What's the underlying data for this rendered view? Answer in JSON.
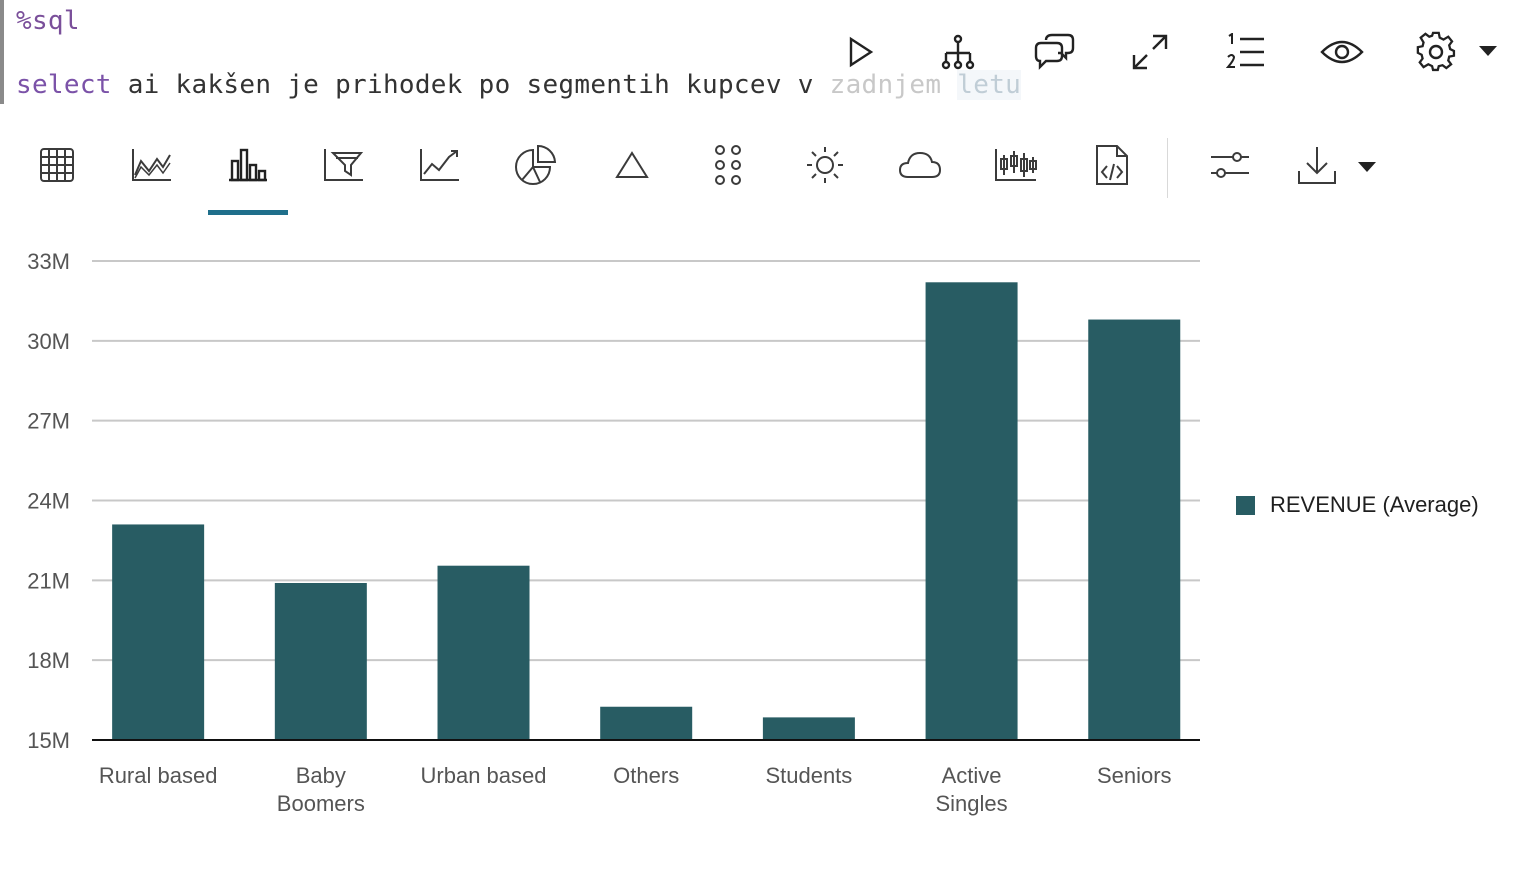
{
  "editor": {
    "line1": "%sql",
    "line2_keyword": "select",
    "line2_text": " ai kakšen je prihodek po segmentih kupcev v ",
    "line2_ghost1": "zadnjem",
    "line2_ghost2": "letu"
  },
  "paragraph_toolbar": {
    "buttons": [
      "run-icon",
      "hierarchy-icon",
      "comments-icon",
      "expand-icon",
      "numbered-list-icon",
      "eye-icon",
      "settings-icon"
    ]
  },
  "viz_toolbar": {
    "buttons": [
      "table-icon",
      "area-chart-icon",
      "bar-chart-icon",
      "funnel-icon",
      "line-chart-icon",
      "pie-chart-icon",
      "pyramid-icon",
      "scatter-icon",
      "sunburst-icon",
      "word-cloud-icon",
      "boxplot-icon",
      "code-file-icon",
      "settings-sliders-icon",
      "download-icon"
    ],
    "active": "bar-chart-icon"
  },
  "colors": {
    "bar": "#285c63",
    "accent": "#1f6f8b",
    "grid": "#c8c8c8"
  },
  "chart_data": {
    "type": "bar",
    "categories": [
      "Rural based",
      "Baby Boomers",
      "Urban based",
      "Others",
      "Students",
      "Active Singles",
      "Seniors"
    ],
    "category_lines": [
      [
        "Rural based"
      ],
      [
        "Baby",
        "Boomers"
      ],
      [
        "Urban based"
      ],
      [
        "Others"
      ],
      [
        "Students"
      ],
      [
        "Active",
        "Singles"
      ],
      [
        "Seniors"
      ]
    ],
    "series": [
      {
        "name": "REVENUE (Average)",
        "values": [
          23.1,
          20.9,
          21.55,
          16.25,
          15.85,
          32.2,
          30.8
        ]
      }
    ],
    "yticks": [
      "15M",
      "18M",
      "21M",
      "24M",
      "27M",
      "30M",
      "33M"
    ],
    "ylim": [
      15,
      33
    ],
    "grid": true,
    "legend": "right"
  }
}
